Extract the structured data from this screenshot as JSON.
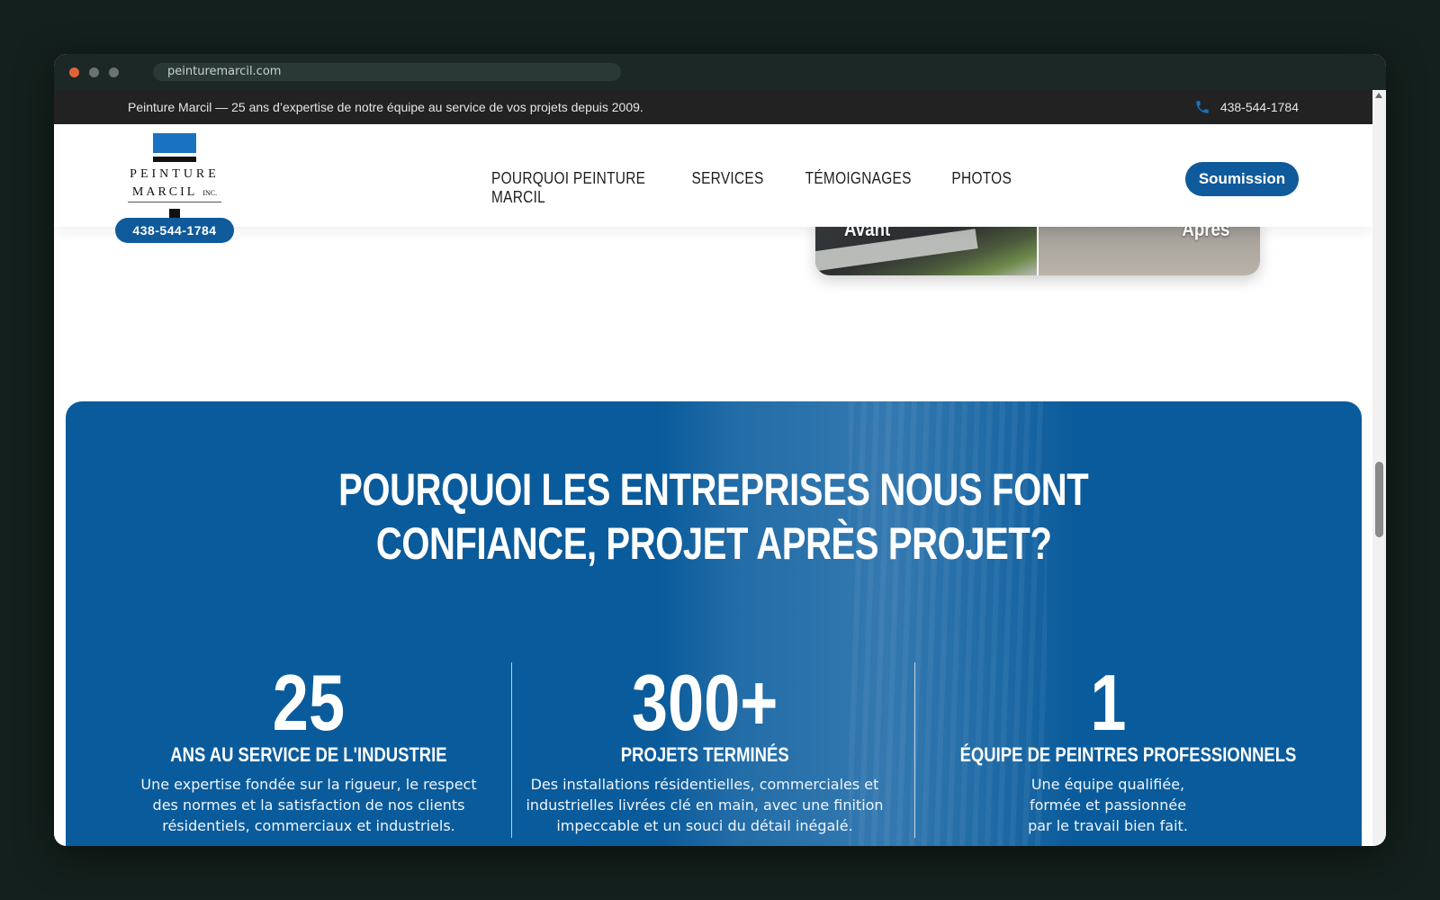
{
  "browser": {
    "url": "peinturemarcil.com"
  },
  "topbar": {
    "message": "Peinture Marcil — 25 ans d’expertise de notre équipe au service de vos projets depuis 2009.",
    "phone": "438-544-1784"
  },
  "nav": {
    "logo_line1": "PEINTURE",
    "logo_line2": "MARCIL",
    "logo_suffix": "INC.",
    "logo_phone": "438-544-1784",
    "menu": [
      "POURQUOI PEINTURE MARCIL",
      "SERVICES",
      "TÉMOIGNAGES",
      "PHOTOS"
    ],
    "cta": "Soumission"
  },
  "comparison": {
    "before": "Avant",
    "after": "Après"
  },
  "hero": {
    "title_line1": "POURQUOI LES ENTREPRISES NOUS FONT",
    "title_line2": "CONFIANCE, PROJET APRÈS PROJET?",
    "accent_color": "#0a5b9b",
    "stats": [
      {
        "number": "25",
        "label": "ANS AU SERVICE DE L'INDUSTRIE",
        "desc_l1": "Une expertise fondée sur la rigueur, le respect",
        "desc_l2": "des normes et la satisfaction de nos clients",
        "desc_l3": "résidentiels, commerciaux et industriels."
      },
      {
        "number": "300+",
        "label": "PROJETS TERMINÉS",
        "desc_l1": "Des installations résidentielles, commerciales et",
        "desc_l2": "industrielles livrées clé en main, avec une finition",
        "desc_l3": "impeccable et un souci du détail inégalé."
      },
      {
        "number": "1",
        "label": "ÉQUIPE DE PEINTRES PROFESSIONNELS",
        "desc_l1": "Une équipe qualifiée,",
        "desc_l2": "formée et passionnée",
        "desc_l3": "par le travail bien fait."
      }
    ]
  }
}
